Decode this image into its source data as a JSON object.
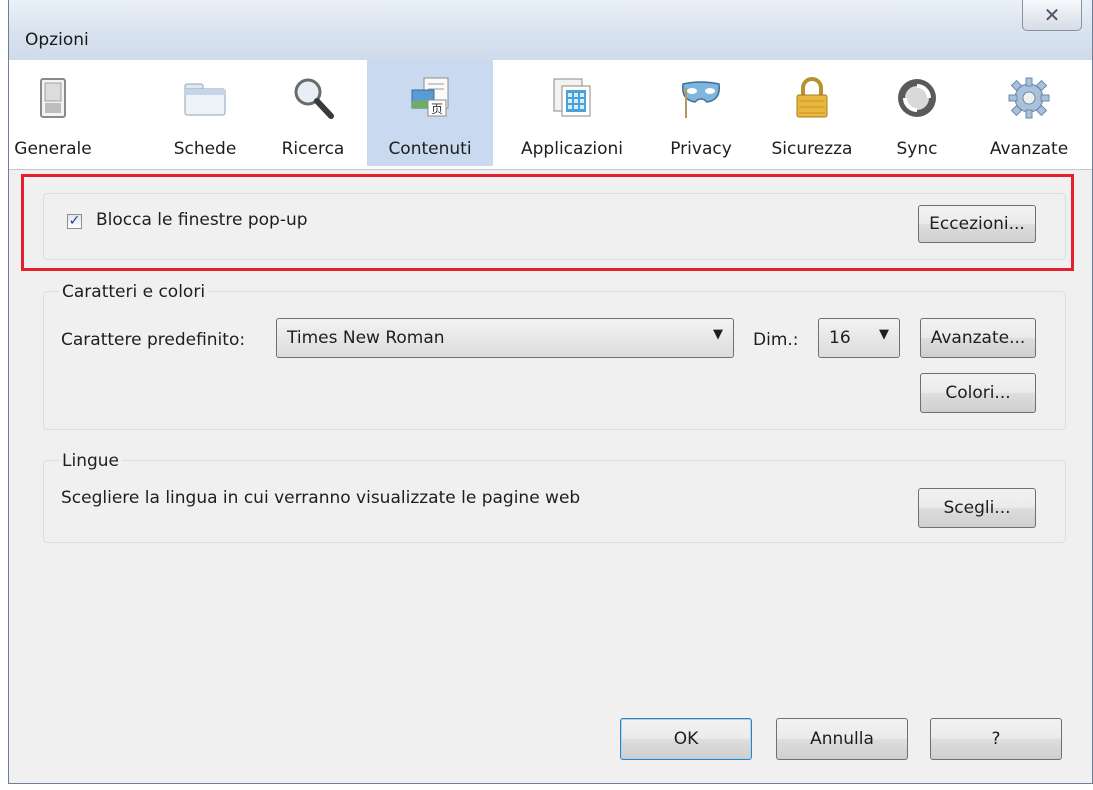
{
  "window": {
    "title": "Opzioni",
    "close_glyph": "✕"
  },
  "toolbar": {
    "items": [
      {
        "label": "Generale",
        "icon": "switch-icon"
      },
      {
        "label": "Schede",
        "icon": "folder-tabs-icon"
      },
      {
        "label": "Ricerca",
        "icon": "magnifier-icon"
      },
      {
        "label": "Contenuti",
        "icon": "content-page-icon",
        "active": true
      },
      {
        "label": "Applicazioni",
        "icon": "applications-icon"
      },
      {
        "label": "Privacy",
        "icon": "mask-icon"
      },
      {
        "label": "Sicurezza",
        "icon": "padlock-icon"
      },
      {
        "label": "Sync",
        "icon": "sync-icon"
      },
      {
        "label": "Avanzate",
        "icon": "gear-icon"
      }
    ]
  },
  "popup": {
    "checkbox_label": "Blocca le finestre pop-up",
    "checked": true,
    "exceptions_button": "Eccezioni..."
  },
  "fonts": {
    "legend": "Caratteri e colori",
    "default_font_label": "Carattere predefinito:",
    "default_font_value": "Times New Roman",
    "size_label": "Dim.:",
    "size_value": "16",
    "advanced_button": "Avanzate...",
    "colors_button": "Colori..."
  },
  "languages": {
    "legend": "Lingue",
    "description": "Scegliere la lingua in cui verranno visualizzate le pagine web",
    "choose_button": "Scegli..."
  },
  "footer": {
    "ok": "OK",
    "cancel": "Annulla",
    "help": "?"
  },
  "colors": {
    "highlight": "#e3202e",
    "active_tab": "#c9d9ef"
  }
}
